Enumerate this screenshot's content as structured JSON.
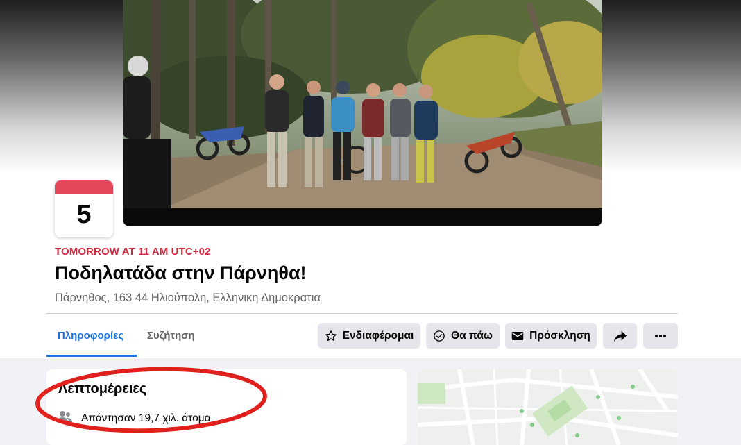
{
  "event": {
    "date_day": "5",
    "time": "TOMORROW AT 11 AM UTC+02",
    "title": "Ποδηλατάδα στην Πάρνηθα!",
    "location": "Πάρνηθος, 163 44 Ηλιούπολη, Ελληνικη Δημοκρατια",
    "cover_alt": "Group photo of riders with motocross bikes on a forest trail"
  },
  "tabs": [
    {
      "label": "Πληροφορίες",
      "active": true
    },
    {
      "label": "Συζήτηση",
      "active": false
    }
  ],
  "actions": {
    "interested": "Ενδιαφέρομαι",
    "going": "Θα πάω",
    "invite": "Πρόσκληση"
  },
  "icons": {
    "interested": "star-icon",
    "going": "check-circle-icon",
    "invite": "envelope-icon",
    "share": "share-arrow-icon",
    "more": "more-dots-icon",
    "responded": "people-icon"
  },
  "details": {
    "title": "Λεπτομέρειες",
    "responded": "Απάντησαν 19,7 χιλ. άτομα"
  },
  "colors": {
    "accent": "#1b74e4",
    "event_time": "#d3293f",
    "calendar_header": "#e4485a",
    "button_bg": "#e4e6eb",
    "annotation": "#e0201c"
  }
}
